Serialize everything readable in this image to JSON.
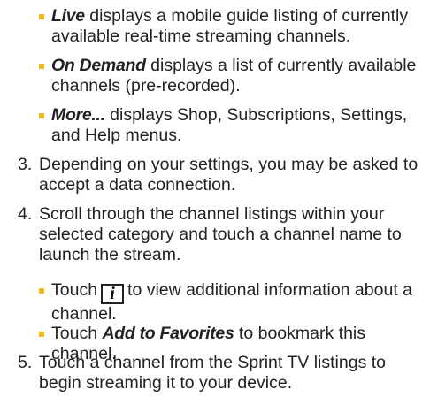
{
  "bullets_top": [
    {
      "em": "Live",
      "text": " displays a mobile guide listing of currently available real-time streaming channels."
    },
    {
      "em": "On Demand",
      "text": " displays a list of currently available channels (pre-recorded)."
    },
    {
      "em": "More...",
      "text": " displays Shop, Subscriptions, Settings, and Help menus."
    }
  ],
  "step3": {
    "num": "3.",
    "text": "Depending on your settings, you may be asked to accept a data connection."
  },
  "step4": {
    "num": "4.",
    "text": "Scroll through the channel listings within your selected category and touch a channel name to launch the stream.",
    "bullet1_pre": "Touch",
    "info_icon_glyph": "i",
    "bullet1_post": "to view additional information about a channel.",
    "bullet2_pre": "Touch ",
    "bullet2_em": "Add to Favorites",
    "bullet2_post": " to bookmark this channel."
  },
  "step5": {
    "num": "5.",
    "text": "Touch a channel from the Sprint TV listings to begin streaming it to your device."
  },
  "colors": {
    "bullet": "#f2b81c",
    "text": "#222222"
  }
}
